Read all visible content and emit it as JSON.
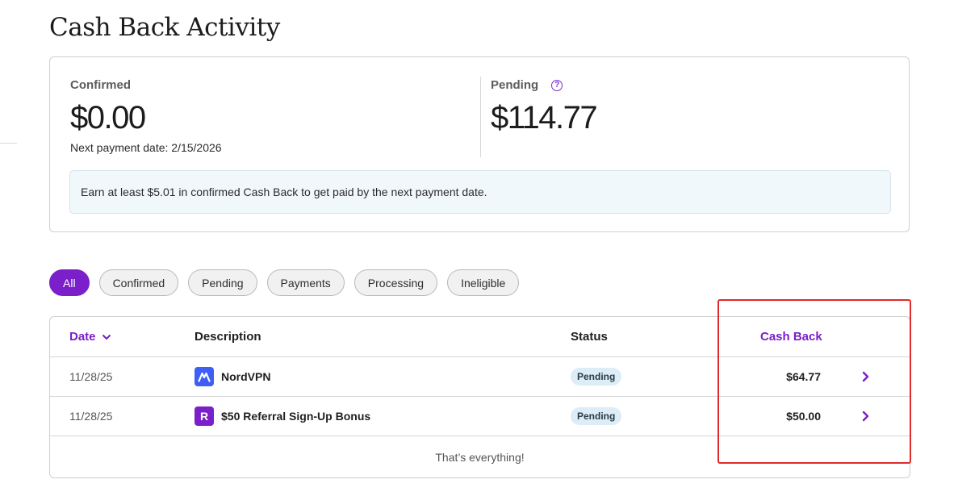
{
  "page": {
    "title": "Cash Back Activity"
  },
  "summary": {
    "confirmed_label": "Confirmed",
    "confirmed_amount": "$0.00",
    "next_payment": "Next payment date: 2/15/2026",
    "pending_label": "Pending",
    "pending_help_icon": "question-circle-icon",
    "pending_amount": "$114.77",
    "notice": "Earn at least $5.01 in confirmed Cash Back to get paid by the next payment date."
  },
  "filters": [
    "All",
    "Confirmed",
    "Pending",
    "Payments",
    "Processing",
    "Ineligible"
  ],
  "filters_active": "All",
  "table": {
    "headers": {
      "date": "Date",
      "description": "Description",
      "status": "Status",
      "cash_back": "Cash Back"
    },
    "rows": [
      {
        "date": "11/28/25",
        "logo": "nordvpn-logo-icon",
        "description": "NordVPN",
        "status": "Pending",
        "amount": "$64.77"
      },
      {
        "date": "11/28/25",
        "logo": "rakuten-logo-icon",
        "logo_letter": "R",
        "description": "$50 Referral Sign-Up Bonus",
        "status": "Pending",
        "amount": "$50.00"
      }
    ],
    "footer": "That’s everything!"
  },
  "colors": {
    "accent": "#7a1fc9",
    "badge_bg": "#dcedf7",
    "notice_bg": "#f1f8fb",
    "highlight": "#e02b2b"
  }
}
